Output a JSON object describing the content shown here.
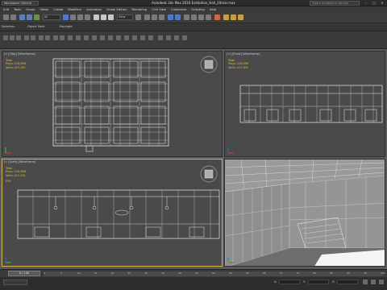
{
  "title_bar": {
    "workspace": "Workspace: Default",
    "title": "Autodesk 3ds Max 2016   Exhibition_Hall_20mar.max",
    "search_placeholder": "Type a keyword or phrase"
  },
  "menus": [
    "Edit",
    "Tools",
    "Group",
    "Views",
    "Create",
    "Modifiers",
    "Animation",
    "Graph Editors",
    "Rendering",
    "Civil View",
    "Customize",
    "Scripting",
    "Help"
  ],
  "toolbar": {
    "selection_filter": "All",
    "reference_coord": "View"
  },
  "ribbon": {
    "tabs": [
      "Selection",
      "Object Paint",
      "Populate"
    ]
  },
  "viewports": {
    "top": {
      "label": "[+] [Top] [Wireframe]",
      "stats": [
        "Total",
        "Polys:  226,698",
        "Verts:  417,301"
      ]
    },
    "front": {
      "label": "[+] [Front] [Wireframe]",
      "stats": [
        "Total",
        "Polys:  226,698",
        "Verts:  417,301"
      ]
    },
    "left": {
      "label": "[+] [Left] [Wireframe]",
      "stats": [
        "Total",
        "Polys:  226,698",
        "Verts:  417,301"
      ],
      "fps": "FPS:"
    },
    "perspective": {
      "label": ""
    }
  },
  "timeline": {
    "slider": "0 / 100",
    "ticks": [
      "0",
      "5",
      "10",
      "15",
      "20",
      "25",
      "30",
      "35",
      "40",
      "45",
      "50",
      "55",
      "60",
      "65",
      "70",
      "75",
      "80",
      "85",
      "90",
      "95",
      "100"
    ]
  },
  "status": {
    "x_label": "X:",
    "x_value": "",
    "y_label": "Y:",
    "y_value": "",
    "z_label": "Z:",
    "z_value": ""
  }
}
